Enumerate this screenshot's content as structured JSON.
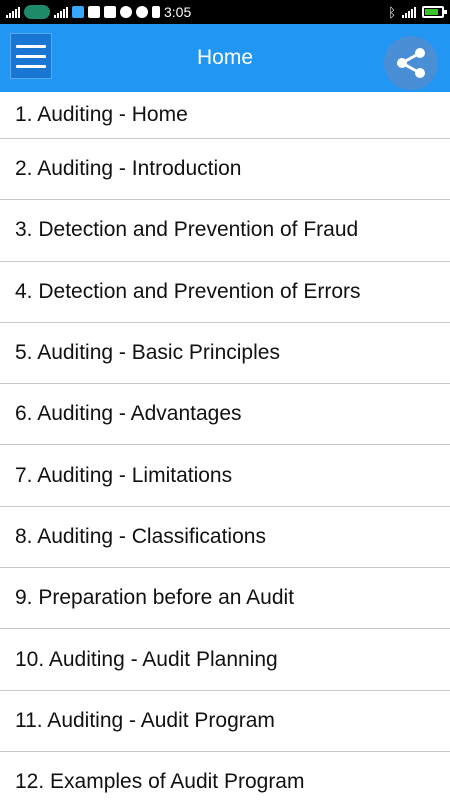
{
  "status_bar": {
    "time": "3:05",
    "icons": [
      "signal-icon",
      "carrier-icon",
      "signal-icon",
      "network-icon",
      "mail-icon",
      "facebook-icon",
      "user-icon",
      "cat-icon",
      "usb-icon",
      "bluetooth-icon",
      "signal-icon",
      "battery-icon"
    ]
  },
  "app_bar": {
    "title": "Home",
    "color": "#2196f3"
  },
  "list": {
    "items": [
      "1. Auditing - Home",
      "2. Auditing - Introduction",
      "3. Detection and Prevention of Fraud",
      "4. Detection and Prevention of Errors",
      "5. Auditing - Basic Principles",
      "6. Auditing - Advantages",
      "7. Auditing - Limitations",
      "8. Auditing - Classifications",
      "9. Preparation before an Audit",
      "10. Auditing - Audit Planning",
      "11. Auditing - Audit Program",
      "12. Examples of Audit Program"
    ]
  }
}
